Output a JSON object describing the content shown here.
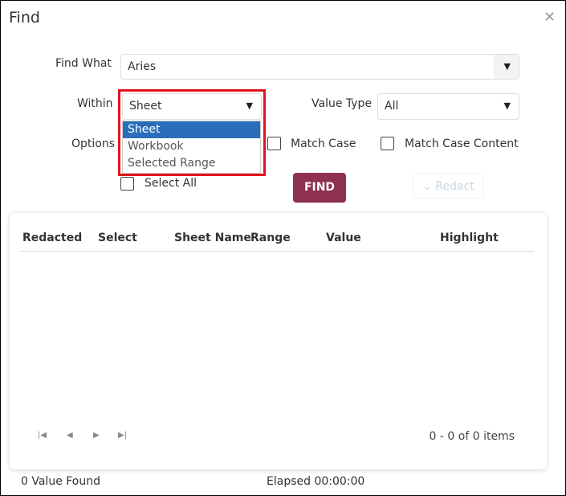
{
  "dialog": {
    "title": "Find",
    "close_icon": "close-icon"
  },
  "form": {
    "find_what_label": "Find What",
    "find_what_value": "Aries",
    "within_label": "Within",
    "within_value": "Sheet",
    "within_options": [
      "Sheet",
      "Workbook",
      "Selected Range"
    ],
    "value_type_label": "Value Type",
    "value_type_value": "All",
    "options_label": "Options",
    "match_case_label": "Match Case",
    "match_case_content_label": "Match Case Content",
    "select_all_label": "Select All",
    "find_button": "FIND",
    "redact_button": "Redact"
  },
  "table": {
    "headers": [
      "Redacted",
      "Select",
      "Sheet Name",
      "Range",
      "Value",
      "Highlight"
    ],
    "pager_info": "0 - 0 of 0 items"
  },
  "footer": {
    "found": "0 Value Found",
    "elapsed": "Elapsed 00:00:00"
  },
  "colors": {
    "find_button": "#8e3050",
    "highlight": "#2a6ebb",
    "annotation_box": "#e0141e"
  }
}
